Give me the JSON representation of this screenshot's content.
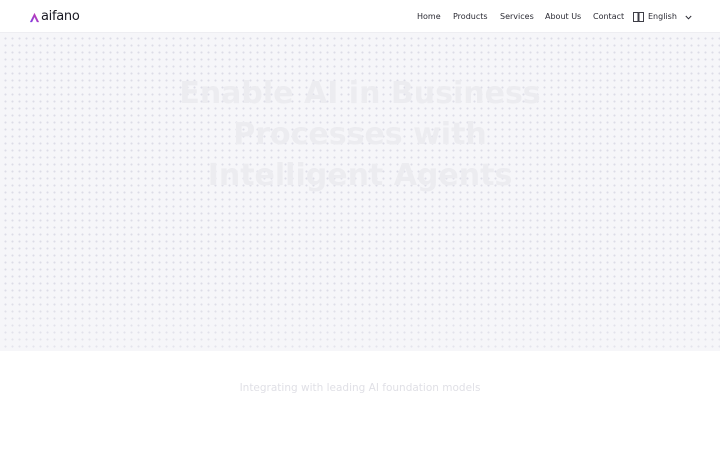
{
  "brand": {
    "name": "aifano",
    "accent_colors": [
      "#7b3fe4",
      "#d63aa6"
    ]
  },
  "nav": {
    "items": [
      {
        "label": "Home"
      },
      {
        "label": "Products"
      },
      {
        "label": "Services"
      },
      {
        "label": "About Us"
      },
      {
        "label": "Contact"
      }
    ],
    "language": {
      "icon": "language-icon",
      "label": "English",
      "chevron": "chevron-down-icon"
    }
  },
  "hero": {
    "title": "Enable AI in Business Processes with Intelligent Agents"
  },
  "partners": {
    "text": "Integrating with leading AI foundation models"
  }
}
